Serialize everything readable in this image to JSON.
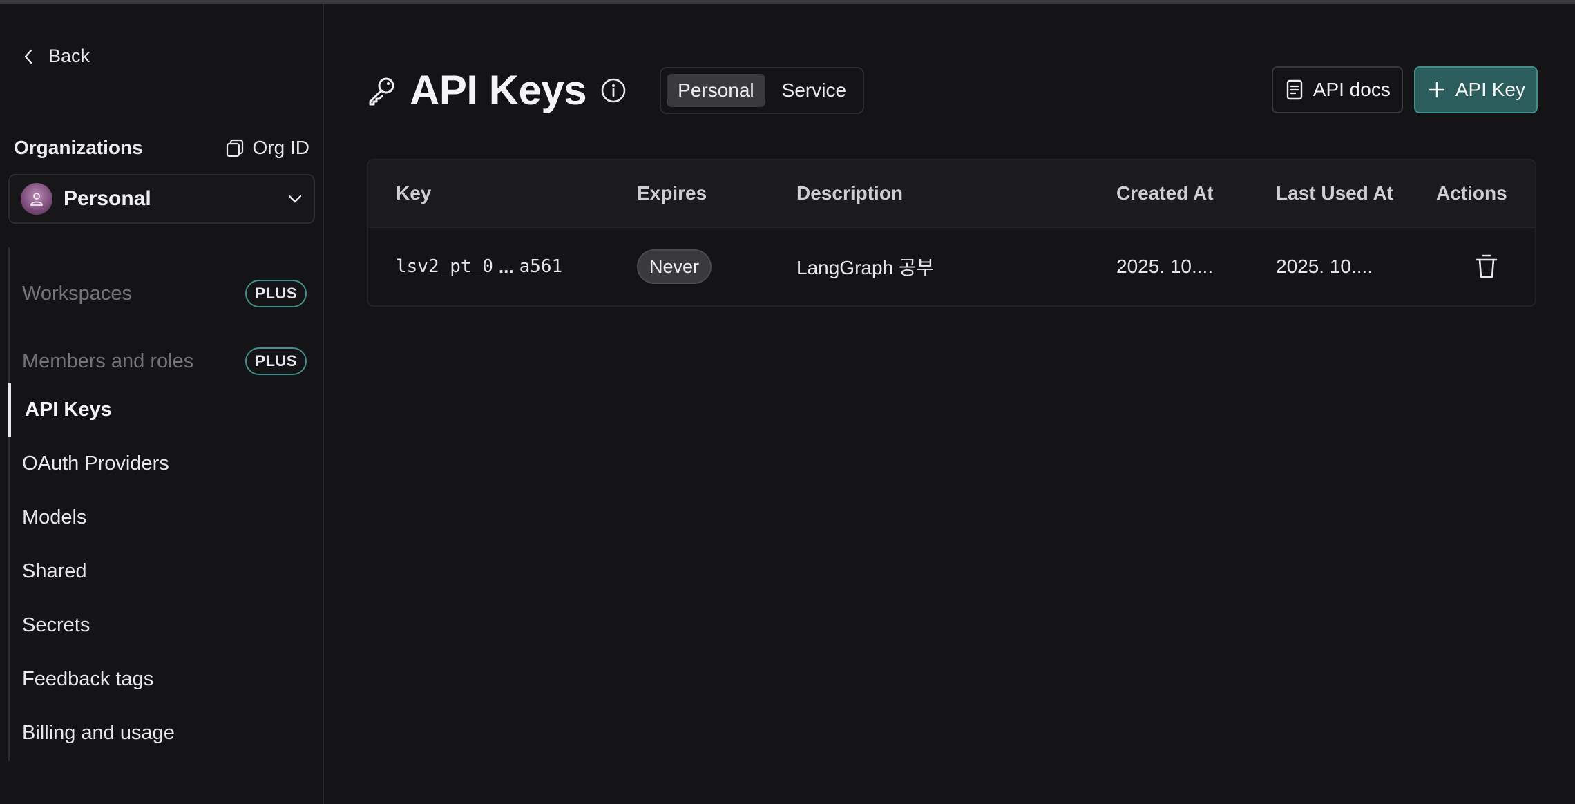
{
  "sidebar": {
    "back_label": "Back",
    "organizations_label": "Organizations",
    "org_id_label": "Org ID",
    "selected_org": "Personal",
    "items": [
      {
        "label": "Workspaces",
        "badge": "PLUS"
      },
      {
        "label": "Members and roles",
        "badge": "PLUS"
      },
      {
        "label": "API Keys"
      },
      {
        "label": "OAuth Providers"
      },
      {
        "label": "Models"
      },
      {
        "label": "Shared"
      },
      {
        "label": "Secrets"
      },
      {
        "label": "Feedback tags"
      },
      {
        "label": "Billing and usage"
      }
    ],
    "active_item": "API Keys"
  },
  "header": {
    "title": "API Keys",
    "tabs": [
      {
        "label": "Personal",
        "active": true
      },
      {
        "label": "Service",
        "active": false
      }
    ],
    "docs_button": "API docs",
    "add_button": "API Key"
  },
  "table": {
    "columns": [
      "Key",
      "Expires",
      "Description",
      "Created At",
      "Last Used At",
      "Actions"
    ],
    "rows": [
      {
        "key_prefix": "lsv2_pt_0",
        "key_ellipsis": "...",
        "key_suffix": "a561",
        "expires": "Never",
        "description": "LangGraph 공부",
        "created_at": "2025. 10....",
        "last_used_at": "2025. 10...."
      }
    ]
  },
  "colors": {
    "background": "#141416",
    "accent": "#2a5d5c",
    "accent_border": "#3f8f8a"
  }
}
